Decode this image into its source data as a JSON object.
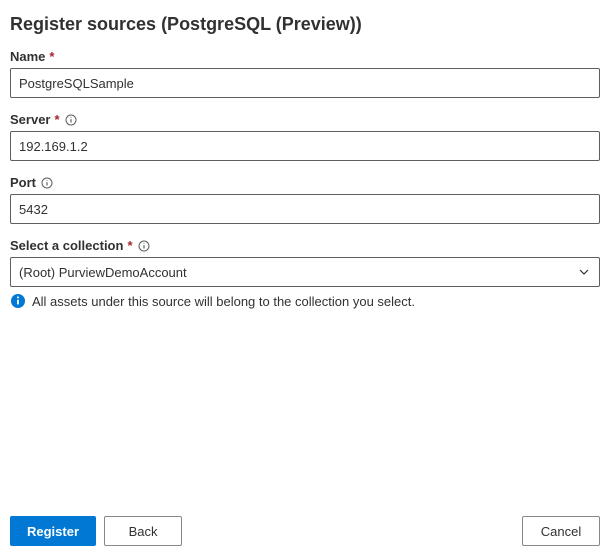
{
  "title": "Register sources (PostgreSQL (Preview))",
  "fields": {
    "name": {
      "label": "Name",
      "required": true,
      "info": false,
      "value": "PostgreSQLSample"
    },
    "server": {
      "label": "Server",
      "required": true,
      "info": true,
      "value": "192.169.1.2"
    },
    "port": {
      "label": "Port",
      "required": false,
      "info": true,
      "value": "5432"
    },
    "collection": {
      "label": "Select a collection",
      "required": true,
      "info": true,
      "selected": "(Root) PurviewDemoAccount"
    }
  },
  "info_message": "All assets under this source will belong to the collection you select.",
  "buttons": {
    "register": "Register",
    "back": "Back",
    "cancel": "Cancel"
  }
}
